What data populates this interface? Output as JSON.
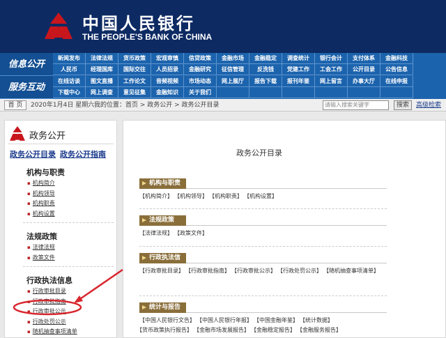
{
  "header": {
    "cn_name": "中国人民银行",
    "en_name": "THE PEOPLE'S BANK OF CHINA",
    "brand_color": "#0d2a63",
    "logo_color": "#c8161d"
  },
  "nav": {
    "label1": "信息公开",
    "label2": "服务互动",
    "rows": [
      [
        "新闻发布",
        "法律法规",
        "货币政策",
        "宏观审慎",
        "信贷政策",
        "金融市场",
        "金融稳定",
        "调查统计",
        "银行会计",
        "支付体系",
        "金融科技"
      ],
      [
        "人民币",
        "经理国库",
        "国际交往",
        "人员招录",
        "金融研究",
        "征信管理",
        "反洗钱",
        "党建工作",
        "工会工作",
        "公开目录",
        "公告信息"
      ],
      [
        "在线访谈",
        "图文直播",
        "工作论文",
        "音频视频",
        "市场动态",
        "网上展厅",
        "报告下载",
        "报刊年鉴",
        "网上留言",
        "办事大厅",
        "在线申报"
      ],
      [
        "下载中心",
        "网上调查",
        "意见征集",
        "金融知识",
        "关于我们",
        "",
        "",
        "",
        "",
        "",
        ""
      ]
    ]
  },
  "crumbbar": {
    "home": "首 页",
    "date": "2020年1月4日 星期六",
    "crumb": "我的位置：首页 > 政务公开 > 政务公开目录",
    "search_placeholder": "请输入搜索关键字",
    "search_button": "搜索",
    "advanced_search": "高级检索"
  },
  "sidebar": {
    "title": "政务公开",
    "link1": "政务公开目录",
    "link2": "政务公开指南",
    "groups": [
      {
        "title": "机构与职责",
        "items": [
          "机构简介",
          "机构领导",
          "机构职责",
          "机构设置"
        ]
      },
      {
        "title": "法规政策",
        "items": [
          "法律法规",
          "政策文件"
        ]
      },
      {
        "title": "行政执法信息",
        "items": [
          "行政审批目录",
          "行政审批指南",
          "行政审批公示",
          "行政处罚公示",
          "随机抽查事项清单"
        ]
      }
    ]
  },
  "main": {
    "title": "政务公开目录",
    "sections": [
      {
        "title": "机构与职责",
        "links": [
          "【机构简介】",
          "【机构领导】",
          "【机构职责】",
          "【机构设置】"
        ]
      },
      {
        "title": "法规政策",
        "links": [
          "【法律法规】",
          "【政策文件】"
        ]
      },
      {
        "title": "行政执法信息",
        "links": [
          "【行政审批目录】",
          "【行政审批指南】",
          "【行政审批公示】",
          "【行政处罚公示】",
          "【随机抽查事项清单】"
        ]
      },
      {
        "title": "统计与报告",
        "links": [
          "【中国人民银行文告】",
          "【中国人民银行年报】",
          "【中国金融年鉴】",
          "【统计数据】",
          "【货币政策执行报告】",
          "【金融市场发展报告】",
          "【金融稳定报告】",
          "【金融服务报告】"
        ]
      }
    ],
    "section_color": "#8a6e3a"
  },
  "annotation_color": "#d8262d"
}
